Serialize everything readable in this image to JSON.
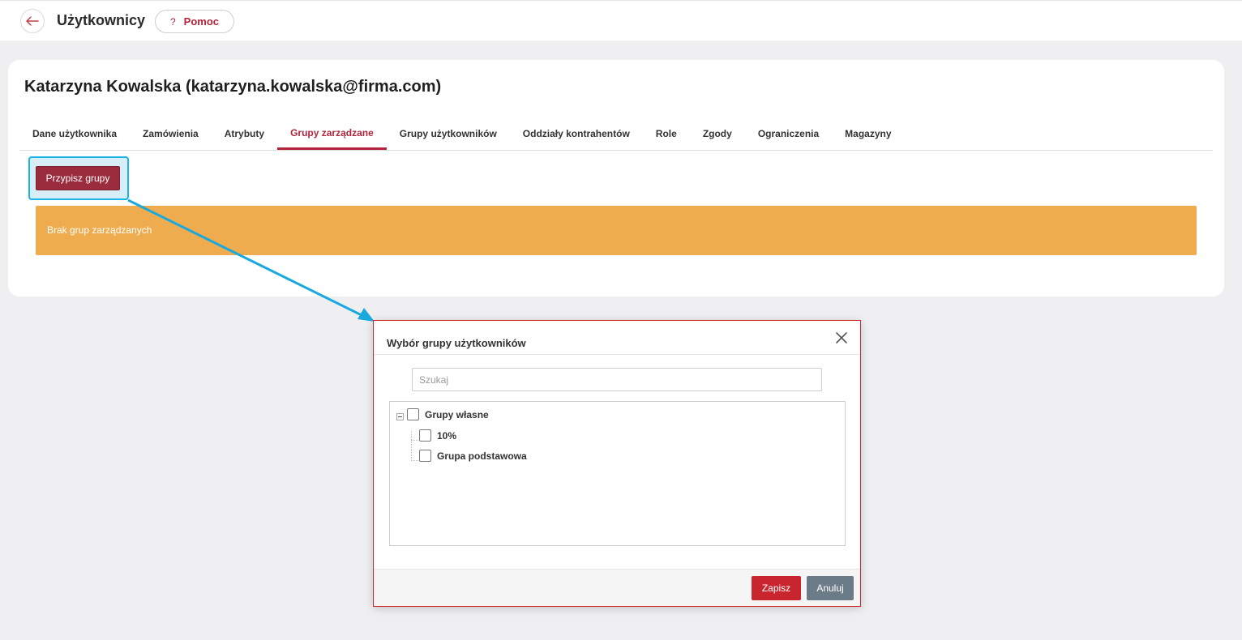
{
  "header": {
    "title": "Użytkownicy",
    "help_label": "Pomoc",
    "help_icon": "?"
  },
  "user": {
    "heading": "Katarzyna Kowalska (katarzyna.kowalska@firma.com)"
  },
  "tabs": [
    {
      "label": "Dane użytkownika",
      "active": false
    },
    {
      "label": "Zamówienia",
      "active": false
    },
    {
      "label": "Atrybuty",
      "active": false
    },
    {
      "label": "Grupy zarządzane",
      "active": true
    },
    {
      "label": "Grupy użytkowników",
      "active": false
    },
    {
      "label": "Oddziały kontrahentów",
      "active": false
    },
    {
      "label": "Role",
      "active": false
    },
    {
      "label": "Zgody",
      "active": false
    },
    {
      "label": "Ograniczenia",
      "active": false
    },
    {
      "label": "Magazyny",
      "active": false
    }
  ],
  "content": {
    "assign_button": "Przypisz grupy",
    "empty_message": "Brak grup zarządzanych"
  },
  "modal": {
    "title": "Wybór grupy użytkowników",
    "search_placeholder": "Szukaj",
    "tree": {
      "root": "Grupy własne",
      "children": [
        "10%",
        "Grupa podstawowa"
      ]
    },
    "save_label": "Zapisz",
    "cancel_label": "Anuluj"
  },
  "colors": {
    "brand": "#b3243a",
    "assign_button": "#9b2c3e",
    "alert": "#efac4e",
    "highlight": "#1ab4e6",
    "save": "#c8252f",
    "cancel": "#6c7b88"
  }
}
